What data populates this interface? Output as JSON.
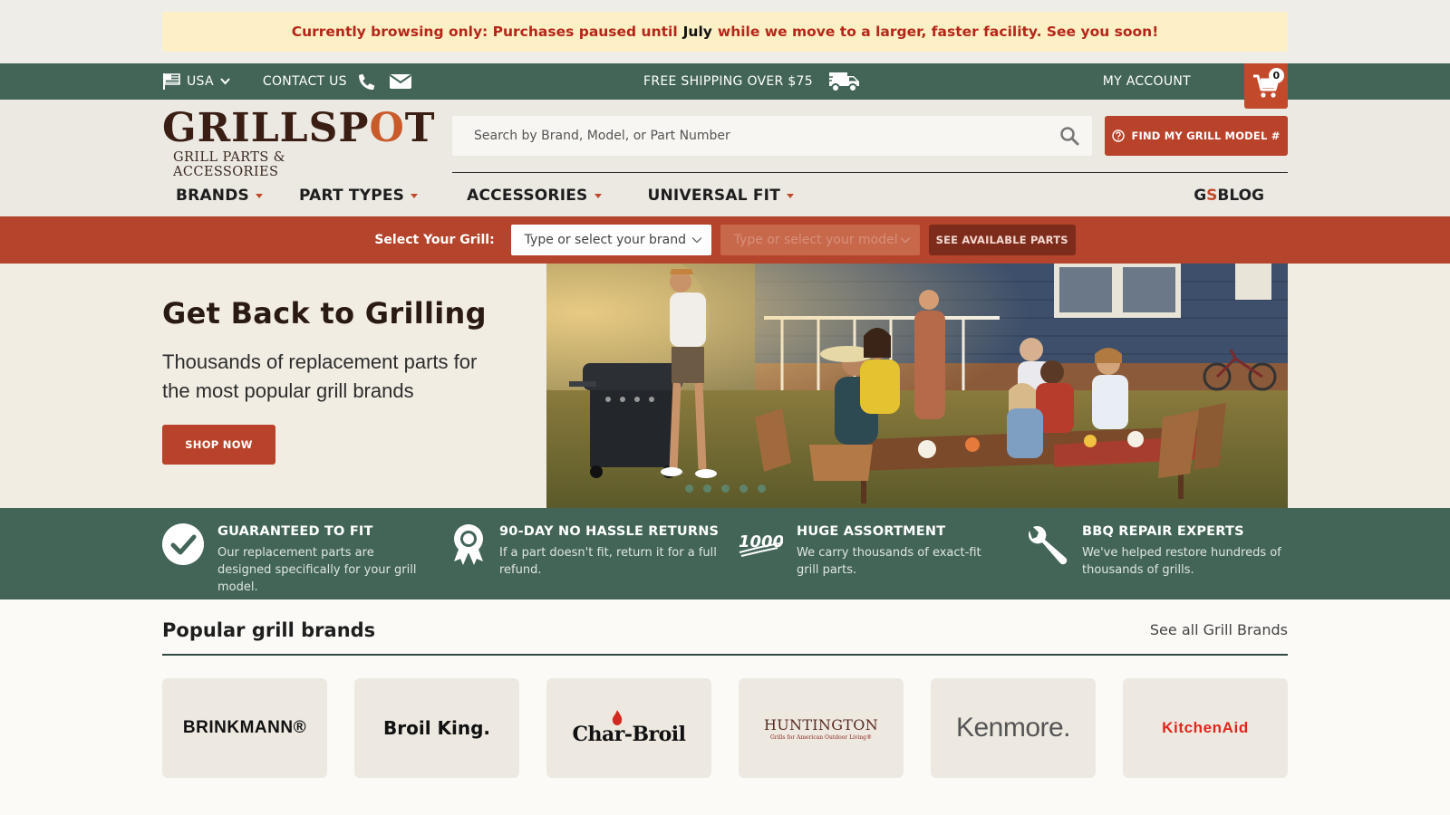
{
  "notice": {
    "part1": "Currently browsing only: Purchases paused until",
    "highlight": "July",
    "part2": "while we move to a larger, faster facility. See you soon!"
  },
  "topbar": {
    "country": "USA",
    "contact": "CONTACT US",
    "shipping": "FREE SHIPPING OVER $75",
    "account": "MY ACCOUNT",
    "cart_count": "0"
  },
  "header": {
    "logo_word_1": "GRILLSP",
    "logo_word_o": "O",
    "logo_word_2": "T",
    "logo_sub": "GRILL PARTS & ACCESSORIES",
    "search_placeholder": "Search by Brand, Model, or Part Number",
    "find_btn": "FIND MY GRILL MODEL #"
  },
  "nav": {
    "items": [
      "BRANDS",
      "PART TYPES",
      "ACCESSORIES",
      "UNIVERSAL FIT"
    ],
    "blog_gs_1": "G",
    "blog_gs_2": "S",
    "blog": "BLOG"
  },
  "selector": {
    "label": "Select Your Grill:",
    "brand_placeholder": "Type or select your brand",
    "model_placeholder": "Type or select your model",
    "button": "SEE AVAILABLE PARTS"
  },
  "hero": {
    "title": "Get Back to Grilling",
    "subtitle": "Thousands of replacement parts for the most popular grill brands",
    "button": "SHOP NOW",
    "slide_count": 5
  },
  "features": [
    {
      "title": "GUARANTEED TO FIT",
      "desc": "Our replacement parts are designed specifically for your grill model.",
      "icon": "check-circle-icon"
    },
    {
      "title": "90-DAY NO HASSLE RETURNS",
      "desc": "If a part doesn't fit, return it for a full refund.",
      "icon": "ribbon-award-icon"
    },
    {
      "title": "HUGE ASSORTMENT",
      "desc": "We carry thousands of exact-fit grill parts.",
      "icon": "thousands-icon",
      "icon_text": "1000's"
    },
    {
      "title": "BBQ REPAIR EXPERTS",
      "desc": "We've helped restore hundreds of thousands of grills.",
      "icon": "wrench-icon"
    }
  ],
  "brands": {
    "title": "Popular grill brands",
    "see_all": "See all Grill Brands",
    "items": [
      {
        "name": "BRINKMANN®"
      },
      {
        "name": "Broil King."
      },
      {
        "name": "Char-Broil"
      },
      {
        "name": "HUNTINGTON",
        "tagline": "Grills for American Outdoor Living®"
      },
      {
        "name": "Kenmore."
      },
      {
        "name": "KitchenAid"
      }
    ]
  },
  "colors": {
    "green": "#426557",
    "rust": "#b4442b",
    "dark_rust": "#7d2c1c",
    "notice_bg": "#fdf0c6",
    "notice_text": "#b5271a"
  }
}
